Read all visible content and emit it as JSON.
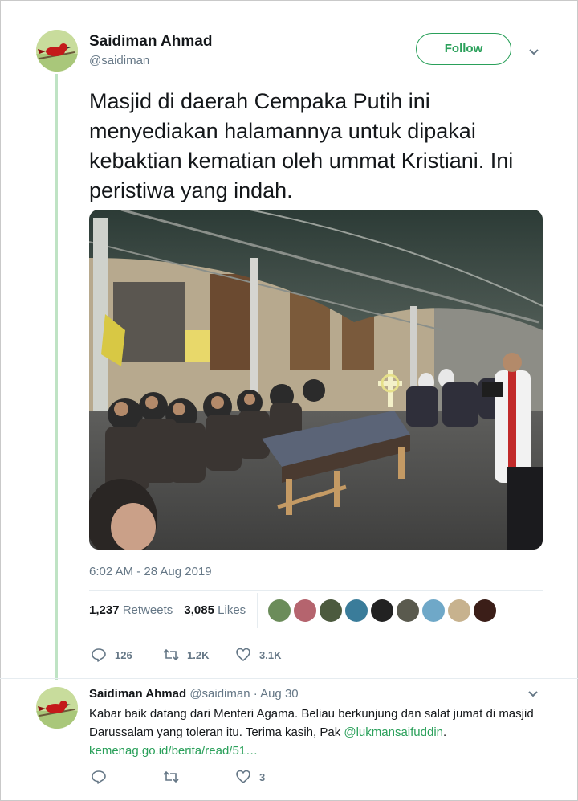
{
  "tweet": {
    "author_name": "Saidiman Ahmad",
    "author_handle": "@saidiman",
    "follow_label": "Follow",
    "text": "Masjid di daerah Cempaka Putih ini menyediakan halamannya untuk dipakai kebaktian kematian oleh ummat Kristiani. Ini peristiwa yang indah.",
    "timestamp": "6:02 AM - 28 Aug 2019",
    "retweets_count": "1,237",
    "retweets_label": "Retweets",
    "likes_count": "3,085",
    "likes_label": "Likes",
    "reply_count": "126",
    "retweet_action_count": "1.2K",
    "like_action_count": "3.1K"
  },
  "reply": {
    "author_name": "Saidiman Ahmad",
    "author_handle": "@saidiman",
    "date": "· Aug 30",
    "text_part1": "Kabar baik datang dari Menteri Agama. Beliau berkunjung dan salat jumat di masjid Darussalam yang toleran itu. Terima kasih, Pak ",
    "mention": "@lukmansaifuddin",
    "text_part2": ".",
    "link": "kemenag.go.id/berita/read/51…",
    "like_count": "3"
  },
  "icons": {
    "reply": "reply-icon",
    "retweet": "retweet-icon",
    "like": "heart-icon",
    "more": "chevron-down-icon"
  },
  "colors": {
    "accent": "#2aa05a",
    "thread_line": "#bfe3c4",
    "secondary_text": "#657786"
  }
}
